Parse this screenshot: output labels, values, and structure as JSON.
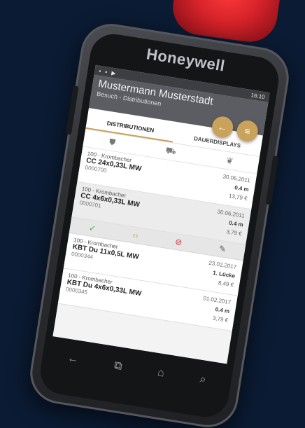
{
  "device": {
    "brand": "Honeywell"
  },
  "statusbar": {
    "time": "16:10"
  },
  "header": {
    "title": "Mustermann Musterstadt",
    "subtitle": "Besuch - Distributionen"
  },
  "fabs": {
    "back_icon": "arrow-left",
    "menu_icon": "menu"
  },
  "tabs": [
    {
      "label": "DISTRIBUTIONEN"
    },
    {
      "label": "DAUERDISPLAYS"
    }
  ],
  "items": [
    {
      "brand": "100 - Krombacher",
      "name": "CC 24x0,33L MW",
      "code": "0000700",
      "date": "30.06.2011",
      "qty": "0.4 m",
      "price": "13,79 €"
    },
    {
      "brand": "100 - Krombacher",
      "name": "CC 4x6x0,33L MW",
      "code": "0000701",
      "date": "30.06.2011",
      "qty": "0.4 m",
      "price": "3,79 €"
    },
    {
      "brand": "100 - Krombacher",
      "name": "KBT Du 11x0,5L MW",
      "code": "0000344",
      "date": "23.02.2017",
      "qty": "1. Lücke",
      "price": "8,49 €"
    },
    {
      "brand": "100 - Krombacher",
      "name": "KBT Du 4x6x0,33L MW",
      "code": "0000345",
      "date": "01.02.2017",
      "qty": "0.4 m",
      "price": "3,79 €"
    }
  ]
}
